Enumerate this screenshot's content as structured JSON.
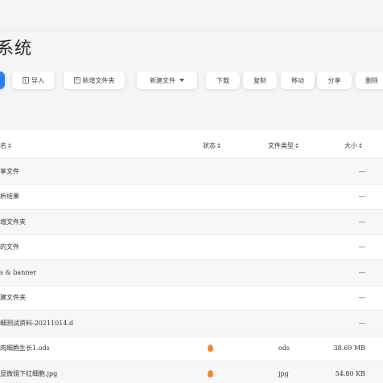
{
  "title": "系统",
  "toolbar": {
    "import_label": "导入",
    "new_folder_label": "新增文件夹",
    "new_file_label": "新建文件",
    "download_label": "下载",
    "copy_label": "复制",
    "move_label": "移动",
    "share_label": "分享",
    "delete_label": "删除"
  },
  "table": {
    "headers": {
      "name": "名",
      "status": "状态",
      "type": "文件类型",
      "size": "大小"
    },
    "rows": [
      {
        "name": "享文件",
        "status": "",
        "type": "",
        "size": "---"
      },
      {
        "name": "析结果",
        "status": "",
        "type": "",
        "size": "---"
      },
      {
        "name": "增文件夹",
        "status": "",
        "type": "",
        "size": "---"
      },
      {
        "name": "的文件",
        "status": "",
        "type": "",
        "size": "---"
      },
      {
        "name": "s & banner",
        "status": "",
        "type": "",
        "size": "---"
      },
      {
        "name": "建文件夹",
        "status": "",
        "type": "",
        "size": "---"
      },
      {
        "name": "细测试资料-20211014.d",
        "status": "",
        "type": "",
        "size": "---"
      },
      {
        "name": "肉细胞生长1.ods",
        "status": "fire-icon",
        "type": "ods",
        "size": "38.69 MB"
      },
      {
        "name": "显微镜下红细胞.jpg",
        "status": "fire-icon",
        "type": "jpg",
        "size": "54.80 KB"
      }
    ]
  }
}
